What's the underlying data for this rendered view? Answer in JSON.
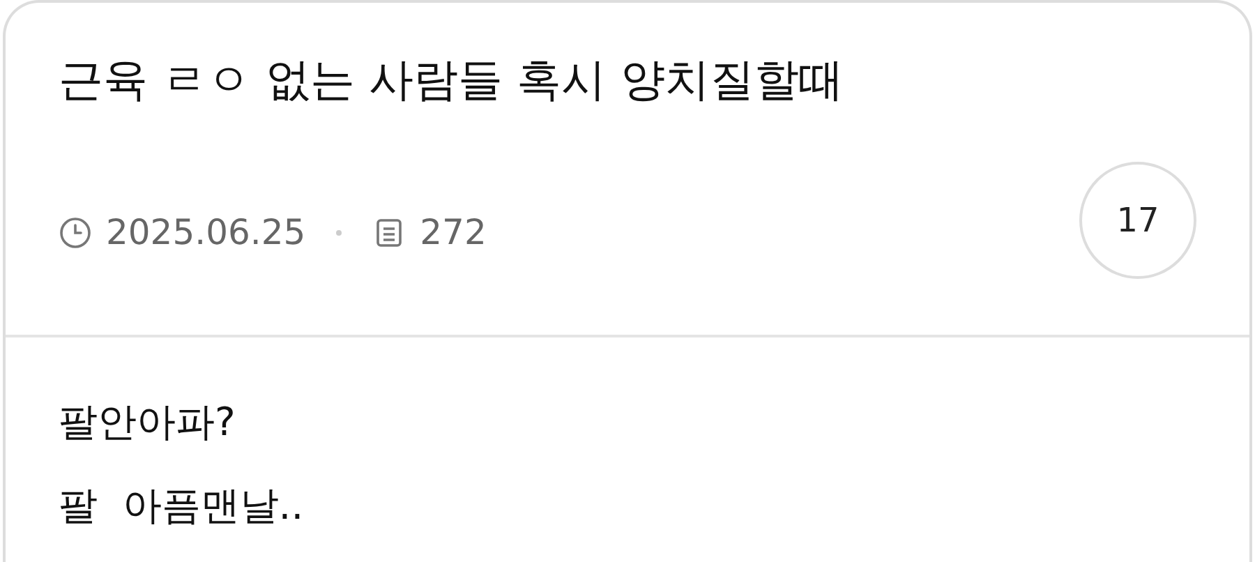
{
  "post": {
    "title": "근육 ㄹㅇ 없는 사람들 혹시 양치질할때",
    "date": "2025.06.25",
    "views": "272",
    "comment_count": "17"
  },
  "body": {
    "lines": [
      "팔안아파?",
      "팔  아픔맨날.."
    ]
  }
}
